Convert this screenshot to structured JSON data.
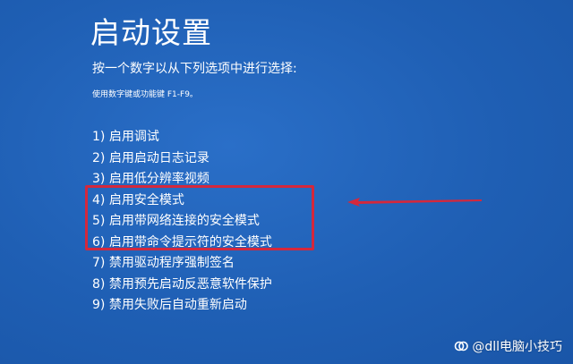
{
  "screen": {
    "title": "启动设置",
    "instruction": "按一个数字以从下列选项中进行选择:",
    "hint": "使用数字键或功能键 F1-F9。"
  },
  "options": [
    {
      "label": "1) 启用调试"
    },
    {
      "label": "2) 启用启动日志记录"
    },
    {
      "label": "3) 启用低分辨率视频"
    },
    {
      "label": "4) 启用安全模式"
    },
    {
      "label": "5) 启用带网络连接的安全模式"
    },
    {
      "label": "6) 启用带命令提示符的安全模式"
    },
    {
      "label": "7) 禁用驱动程序强制签名"
    },
    {
      "label": "8) 禁用预先启动反恶意软件保护"
    },
    {
      "label": "9) 禁用失败后自动重新启动"
    }
  ],
  "annotation": {
    "highlight_color": "#d4283c"
  },
  "watermark": {
    "text": "@dll电脑小技巧",
    "icon": "watermark-logo-icon"
  },
  "colors": {
    "background": "#1f5fb4",
    "text": "#ffffff"
  }
}
